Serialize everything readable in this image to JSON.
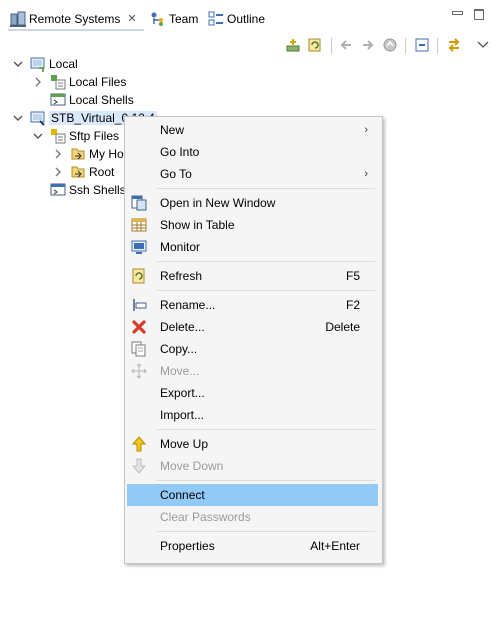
{
  "tabs": [
    {
      "label": "Remote Systems",
      "close": "✕"
    },
    {
      "label": "Team"
    },
    {
      "label": "Outline"
    }
  ],
  "tree": {
    "local": "Local",
    "local_files": "Local Files",
    "local_shells": "Local Shells",
    "stb": "STB_Virtual_0.12.4",
    "sftp_files": "Sftp Files",
    "my_home": "My Ho",
    "root": "Root",
    "ssh_shells": "Ssh Shells"
  },
  "menu": {
    "new": "New",
    "go_into": "Go Into",
    "go_to": "Go To",
    "open_new_window": "Open in New Window",
    "show_in_table": "Show in Table",
    "monitor": "Monitor",
    "refresh": "Refresh",
    "refresh_key": "F5",
    "rename": "Rename...",
    "rename_key": "F2",
    "delete": "Delete...",
    "delete_key": "Delete",
    "copy": "Copy...",
    "move": "Move...",
    "export": "Export...",
    "import": "Import...",
    "move_up": "Move Up",
    "move_down": "Move Down",
    "connect": "Connect",
    "clear_passwords": "Clear Passwords",
    "properties": "Properties",
    "properties_key": "Alt+Enter",
    "submenu_arrow": "›"
  },
  "colors": {
    "highlight": "#91c9f7",
    "selection": "#d9e8fb",
    "disabled_text": "#9a9a9a",
    "menu_bg": "#f5f5f5"
  }
}
